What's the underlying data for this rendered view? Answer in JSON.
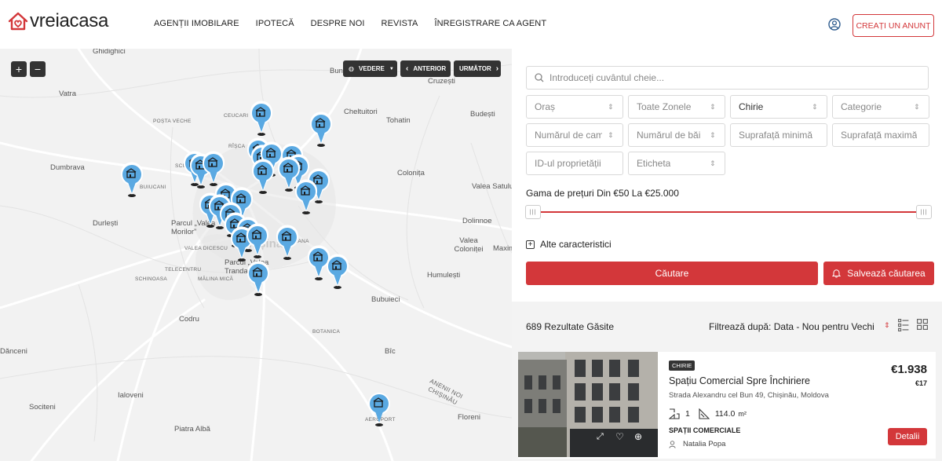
{
  "header": {
    "logo_text": "vreiacasa",
    "nav": [
      "AGENȚII IMOBILARE",
      "IPOTECĂ",
      "DESPRE NOI",
      "REVISTA",
      "ÎNREGISTRARE CA AGENT"
    ],
    "create_button": "CREAȚI UN ANUNȚ"
  },
  "map": {
    "zoom_in": "+",
    "zoom_out": "−",
    "view_label": "VEDERE",
    "prev_label": "ANTERIOR",
    "next_label": "URMĂTOR",
    "places": [
      "Ghidighici",
      "Vatra",
      "POȘTA VECHE",
      "CEUCARI",
      "RÎȘCA",
      "Cheltuitori",
      "Tohatin",
      "Budești",
      "Bun",
      "Cruzești",
      "Dumbrava",
      "SCULE",
      "BUIUCANI",
      "Colonița",
      "Valea Satului",
      "Durlești",
      "Parcul „Valea Morilor”",
      "CIOCANA",
      "Dolinnoe",
      "VALEA DICESCU",
      "Valea Coloniței",
      "Maxim",
      "Chișinău",
      "TELECENTRU",
      "Parcul „Valea Trandafirilor”",
      "SCHINOASA",
      "MĂLINA MICĂ",
      "Humulești",
      "Bubuieci",
      "Codru",
      "BOTANICA",
      "Dănceni",
      "Bîc",
      "Ialoveni",
      "ANENII NOI CHIȘINĂU",
      "Sociteni",
      "Floreni",
      "Piatra Albă",
      "AEROPORT"
    ]
  },
  "search": {
    "placeholder": "Introduceți cuvântul cheie..."
  },
  "filters": {
    "city": "Oraș",
    "zones": "Toate Zonele",
    "deal": "Chirie",
    "category": "Categorie",
    "rooms": "Numărul de camere",
    "baths": "Numărul de băi",
    "min_area": "Suprafață minimă",
    "max_area": "Suprafață maximă",
    "property_id": "ID-ul proprietății",
    "tag": "Eticheta"
  },
  "price": {
    "label": "Gama de prețuri",
    "from_word": "Din",
    "from": "€50",
    "to_word": "La",
    "to": "€25.000"
  },
  "more_features": "Alte caracteristici",
  "search_button": "Căutare",
  "save_search_button": "Salvează căutarea",
  "results": {
    "count": "689 Rezultate Găsite",
    "filter_label": "Filtrează după:",
    "filter_value": "Data - Nou pentru Vechi"
  },
  "listing": {
    "badge": "CHIRIE",
    "title": "Spațiu Comercial Spre Închiriere",
    "address": "Strada Alexandru cel Bun 49, Chișinău, Moldova",
    "price": "€1.938",
    "price_sub": "€17",
    "rooms": "1",
    "area": "114.0",
    "area_unit": "m²",
    "type": "SPAȚII COMERCIALE",
    "agent": "Natalia Popa",
    "details_button": "Detalii"
  }
}
